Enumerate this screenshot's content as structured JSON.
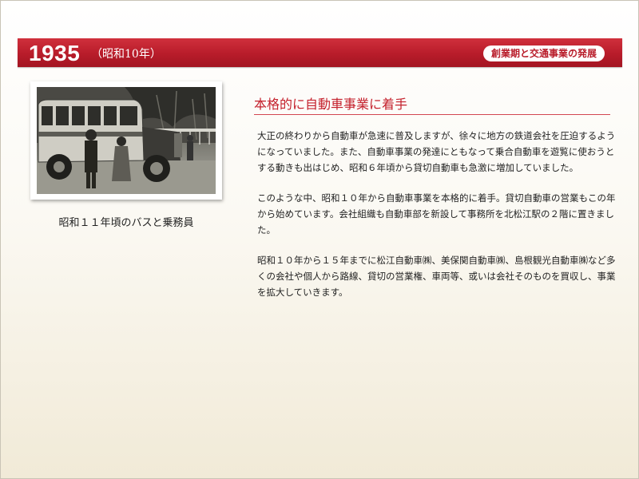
{
  "header": {
    "year": "1935",
    "era": "（昭和10年）",
    "section_badge": "創業期と交通事業の発展",
    "accent_color": "#b81c2a"
  },
  "photo": {
    "caption": "昭和１１年頃のバスと乗務員"
  },
  "article": {
    "title": "本格的に自動車事業に着手",
    "paragraphs": [
      "大正の終わりから自動車が急速に普及しますが、徐々に地方の鉄道会社を圧迫するようになっていました。また、自動車事業の発達にともなって乗合自動車を遊覧に使おうとする動きも出はじめ、昭和６年頃から貸切自動車も急激に増加していました。",
      "このような中、昭和１０年から自動車事業を本格的に着手。貸切自動車の営業もこの年から始めています。会社組織も自動車部を新設して事務所を北松江駅の２階に置きました。",
      "昭和１０年から１５年までに松江自動車㈱、美保関自動車㈱、島根観光自動車㈱など多くの会社や個人から路線、貸切の営業権、車両等、或いは会社そのものを買収し、事業を拡大していきます。"
    ]
  }
}
